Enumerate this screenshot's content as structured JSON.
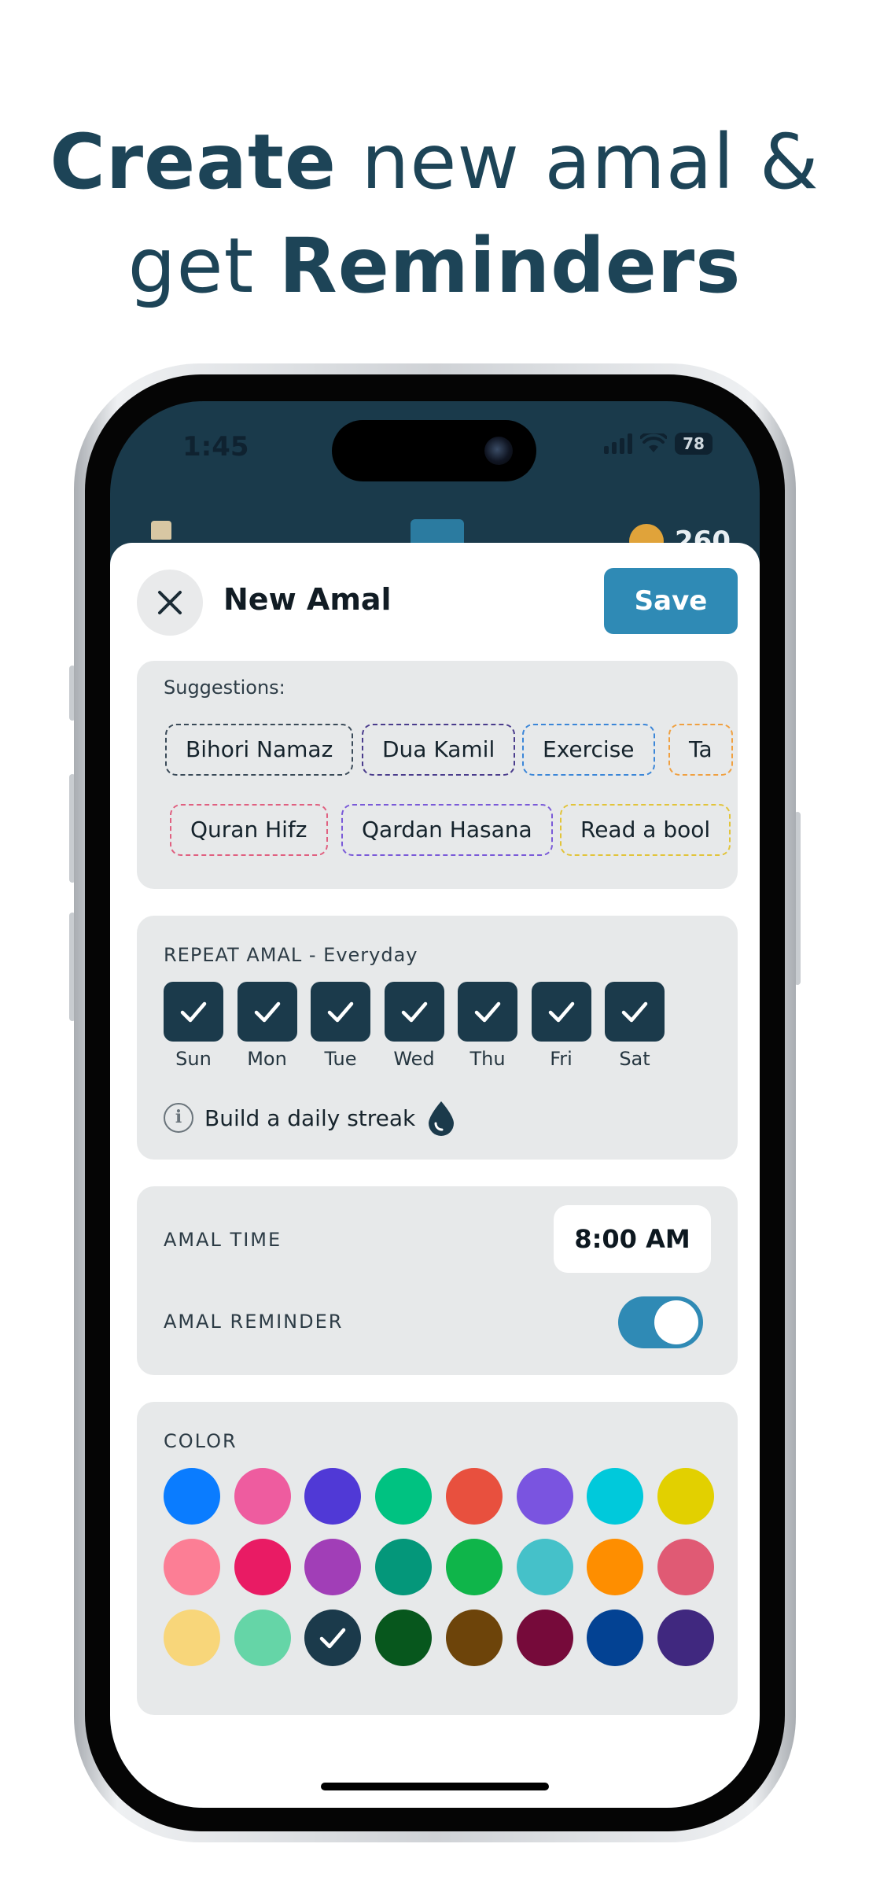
{
  "headline": {
    "part1_bold": "Create",
    "part1_rest": " new amal &",
    "part2_start": "get ",
    "part2_bold": "Reminders"
  },
  "status_bar": {
    "time": "1:45",
    "battery": "78"
  },
  "behind_header": {
    "coin_count": "260"
  },
  "sheet": {
    "title": "New Amal",
    "save_label": "Save",
    "close_icon": "close-icon"
  },
  "suggestions": {
    "label": "Suggestions:",
    "row1": [
      {
        "text": "Bihori Namaz",
        "color": "#3a4a58"
      },
      {
        "text": "Dua Kamil",
        "color": "#4a3c8c"
      },
      {
        "text": "Exercise",
        "color": "#3b86d8"
      },
      {
        "text": "Ta",
        "color": "#f0a040"
      }
    ],
    "row2": [
      {
        "text": "Quran Hifz",
        "color": "#e06080"
      },
      {
        "text": "Qardan Hasana",
        "color": "#7a5ad8"
      },
      {
        "text": "Read a bool",
        "color": "#e2c43a"
      }
    ]
  },
  "repeat": {
    "label": "REPEAT AMAL - Everyday",
    "days": [
      "Sun",
      "Mon",
      "Tue",
      "Wed",
      "Thu",
      "Fri",
      "Sat"
    ],
    "info_text": "Build a daily streak",
    "info_icon": "info-icon",
    "streak_icon": "drop-icon"
  },
  "time": {
    "label": "AMAL TIME",
    "value": "8:00 AM",
    "reminder_label": "AMAL REMINDER",
    "reminder_on": true
  },
  "color": {
    "label": "COLOR",
    "selected": "#1b3a4b",
    "swatches": [
      "#0a7cff",
      "#ee5c9f",
      "#5039d6",
      "#00c281",
      "#e8503e",
      "#7a54e0",
      "#00c9db",
      "#e2d000",
      "#fc7e95",
      "#e91b64",
      "#a13eb7",
      "#04977a",
      "#0fb54a",
      "#45c1c9",
      "#fe8e00",
      "#e05a74",
      "#f8d67a",
      "#65d5a7",
      "#1b3a4b",
      "#07571d",
      "#6d440a",
      "#760a3a",
      "#034293",
      "#40287f"
    ]
  }
}
